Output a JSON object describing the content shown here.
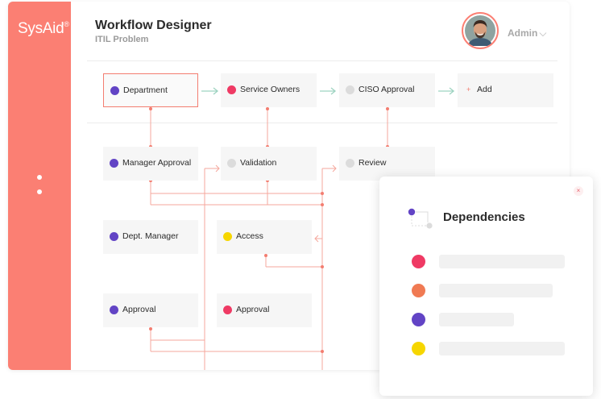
{
  "app": {
    "logo": "SysAid",
    "logo_mark": "®"
  },
  "header": {
    "title": "Workflow Designer",
    "subtitle": "ITIL Problem",
    "user": "Admin",
    "chevron": "⌵"
  },
  "colors": {
    "accent": "#fb7f73",
    "purple": "#6244c5",
    "pink": "#ef3a64",
    "grey": "#dcdcdc",
    "yellow": "#f6d600",
    "orange": "#f07a53"
  },
  "nodes": {
    "department": "Department",
    "service_owners": "Service Owners",
    "ciso_approval": "CISO Approval",
    "add": "Add",
    "add_icon": "+",
    "manager_approval": "Manager Approval",
    "validation": "Validation",
    "review": "Review",
    "dept_manager": "Dept. Manager",
    "access": "Access",
    "approval_1": "Approval",
    "approval_2": "Approval"
  },
  "dependencies": {
    "title": "Dependencies",
    "close": "×"
  }
}
